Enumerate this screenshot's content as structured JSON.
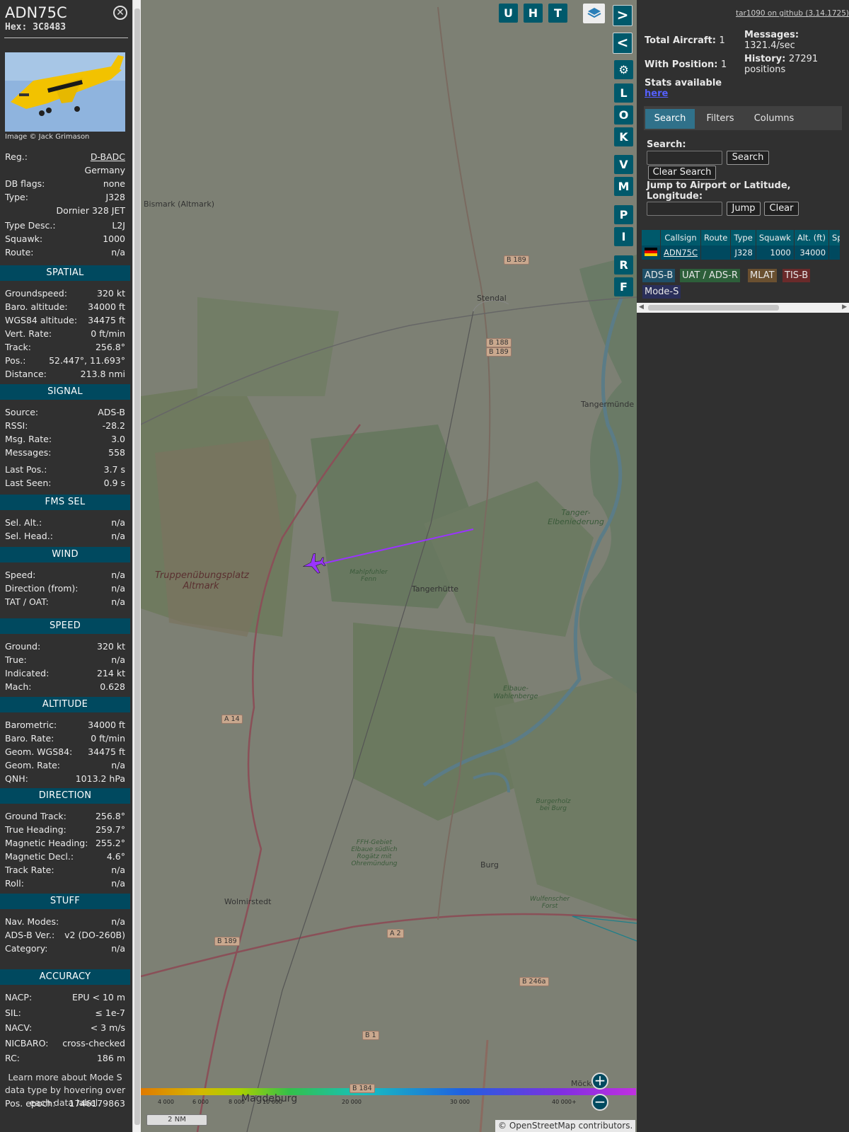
{
  "sidebar": {
    "callsign": "ADN75C",
    "hex": "Hex: 3C8483",
    "close_icon": "circled-x",
    "photo_credit": "Image © Jack Grimason",
    "info": [
      {
        "k": "Reg.:",
        "v": "D-BADC",
        "link": true
      },
      {
        "k": "",
        "v": "Germany"
      },
      {
        "k": "DB flags:",
        "v": "none"
      },
      {
        "k": "Type:",
        "v": "J328"
      },
      {
        "k": "",
        "v": "Dornier 328 JET"
      },
      {
        "k": "Type Desc.:",
        "v": "L2J"
      },
      {
        "k": "Squawk:",
        "v": "1000"
      },
      {
        "k": "Route:",
        "v": "n/a"
      }
    ],
    "sections": [
      {
        "title": "SPATIAL",
        "rows": [
          [
            "Groundspeed:",
            "320 kt"
          ],
          [
            "Baro. altitude:",
            "34000 ft"
          ],
          [
            "WGS84 altitude:",
            "34475 ft"
          ],
          [
            "Vert. Rate:",
            "0 ft/min"
          ],
          [
            "Track:",
            "256.8°"
          ],
          [
            "Pos.:",
            "52.447°, 11.693°"
          ],
          [
            "Distance:",
            "213.8 nmi"
          ]
        ]
      },
      {
        "title": "SIGNAL",
        "rows": [
          [
            "Source:",
            "ADS-B"
          ],
          [
            "RSSI:",
            "-28.2"
          ],
          [
            "Msg. Rate:",
            "3.0"
          ],
          [
            "Messages:",
            "558"
          ],
          [
            "Last Pos.:",
            "3.7 s"
          ],
          [
            "Last Seen:",
            "0.9 s"
          ]
        ]
      },
      {
        "title": "FMS SEL",
        "rows": [
          [
            "Sel. Alt.:",
            "n/a"
          ],
          [
            "Sel. Head.:",
            "n/a"
          ]
        ]
      },
      {
        "title": "WIND",
        "rows": [
          [
            "Speed:",
            "n/a"
          ],
          [
            "Direction (from):",
            "n/a"
          ],
          [
            "TAT / OAT:",
            "n/a"
          ]
        ]
      },
      {
        "title": "SPEED",
        "rows": [
          [
            "Ground:",
            "320 kt"
          ],
          [
            "True:",
            "n/a"
          ],
          [
            "Indicated:",
            "214 kt"
          ],
          [
            "Mach:",
            "0.628"
          ]
        ]
      },
      {
        "title": "ALTITUDE",
        "rows": [
          [
            "Barometric:",
            "34000 ft"
          ],
          [
            "Baro. Rate:",
            "0 ft/min"
          ],
          [
            "Geom. WGS84:",
            "34475 ft"
          ],
          [
            "Geom. Rate:",
            "n/a"
          ],
          [
            "QNH:",
            "1013.2 hPa"
          ]
        ]
      },
      {
        "title": "DIRECTION",
        "rows": [
          [
            "Ground Track:",
            "256.8°"
          ],
          [
            "True Heading:",
            "259.7°"
          ],
          [
            "Magnetic Heading:",
            "255.2°"
          ],
          [
            "Magnetic Decl.:",
            "4.6°"
          ],
          [
            "Track Rate:",
            "n/a"
          ],
          [
            "Roll:",
            "n/a"
          ]
        ]
      },
      {
        "title": "STUFF",
        "rows": [
          [
            "Nav. Modes:",
            "n/a"
          ],
          [
            "ADS-B Ver.:",
            "v2 (DO-260B)"
          ],
          [
            "Category:",
            "n/a"
          ]
        ]
      },
      {
        "title": "ACCURACY",
        "rows": [
          [
            "NACP:",
            "EPU < 10 m"
          ],
          [
            "SIL:",
            "≤ 1e-7"
          ],
          [
            "NACV:",
            "< 3 m/s"
          ],
          [
            "NICBARO:",
            "cross-checked"
          ],
          [
            "RC:",
            "186 m"
          ]
        ]
      }
    ],
    "note": "Learn more about Mode S data type by hovering over each data label.",
    "epoch_label": "Pos. epoch:",
    "epoch_value": "1746179863"
  },
  "map": {
    "buttons_top": [
      "U",
      "H",
      "T"
    ],
    "buttons_side": [
      "L",
      "O",
      "K",
      "V",
      "M",
      "P",
      "I",
      "R",
      "F"
    ],
    "places": [
      "Bismark (Altmark)",
      "Stendal",
      "Tangermünde",
      "Tanger-Elbeniederung",
      "Truppenübungsplatz Altmark",
      "Mahlpfuhler Fenn",
      "Tangerhütte",
      "Elbaue-Wahlenberge",
      "Burgerholz bei Burg",
      "FFH-Gebiet Elbaue südlich Rogätz mit Ohremündung",
      "Burg",
      "Wolmirstedt",
      "Wulfenscher Forst",
      "Magdeburg",
      "Möckern"
    ],
    "roads": [
      "B 189",
      "B 188",
      "B 189",
      "A 14",
      "A 2",
      "B 189",
      "B 246a",
      "B 1",
      "B 184"
    ],
    "altitude_scale": [
      "4 000",
      "6 000",
      "8 000",
      "10 000",
      "20 000",
      "30 000",
      "40 000+"
    ],
    "scale_bar": "2 NM",
    "attribution": "© OpenStreetMap contributors."
  },
  "panel": {
    "github": "tar1090 on github (3.14.1725)",
    "total_aircraft": "Total Aircraft: ",
    "total_aircraft_val": "1",
    "with_position": "With Position: ",
    "with_position_val": "1",
    "messages_label": "Messages:",
    "messages_val": "1321.4/sec",
    "history_label": "History: ",
    "history_val": "27291 positions",
    "stats_label": "Stats available",
    "stats_link": "here",
    "tabs": [
      "Search",
      "Filters",
      "Columns"
    ],
    "search_label": "Search:",
    "search_btn": "Search",
    "clear_search_btn": "Clear Search",
    "jump_label": "Jump to Airport or Latitude, Longitude:",
    "jump_btn": "Jump",
    "clear_btn": "Clear",
    "table_headers": [
      "Callsign",
      "Route",
      "Type",
      "Squawk",
      "Alt. (ft)",
      "Spd."
    ],
    "table_rows": [
      {
        "callsign": "ADN75C",
        "route": "",
        "type": "J328",
        "squawk": "1000",
        "alt": "34000",
        "spd": ""
      }
    ],
    "legend": [
      {
        "label": "ADS-B",
        "color": "#1f4f68"
      },
      {
        "label": "UAT / ADS-R",
        "color": "#2d5f3a"
      },
      {
        "label": "MLAT",
        "color": "#6a5030"
      },
      {
        "label": "TIS-B",
        "color": "#6a2a2a"
      },
      {
        "label": "Mode-S",
        "color": "#2a2f5a"
      }
    ]
  }
}
